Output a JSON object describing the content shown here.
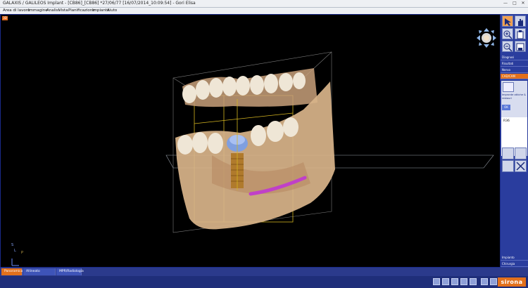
{
  "window": {
    "title": "GALAXIS / GALILEOS Implant - [CB86]_[CB86] *27/06/77 [16/07/2014_10:09:54] - Gori Elisa",
    "controls": {
      "minimize": "—",
      "maximize": "□",
      "close": "✕"
    }
  },
  "menu": [
    "Area di lavoro",
    "Immagine",
    "Analisi",
    "Vista",
    "Pianificazione",
    "Impianto",
    "Aiuto"
  ],
  "viewport": {
    "label": "3D"
  },
  "orientation": {
    "s": "S",
    "l": "L",
    "p": "P"
  },
  "right_panel": {
    "categories": [
      "Diagnosi",
      "Risultati",
      "Nervo",
      "CAD/CAM"
    ],
    "active_category": "CAD/CAM",
    "section_title": "Impronte ottiche & restauri",
    "restorations": [
      {
        "label": "OK"
      },
      {
        "label": "R36"
      }
    ],
    "bottom_items": [
      "Impianto",
      "Chirurgia"
    ]
  },
  "tabs": [
    {
      "label": "Panoramica",
      "active": true
    },
    {
      "label": "Allineato all'impianto",
      "active": false
    },
    {
      "label": "MPR/Radiologia",
      "active": false
    }
  ],
  "brand": {
    "name": "sirona"
  },
  "colors": {
    "accent": "#e2701c",
    "panel": "#2a3d9e",
    "bone": "#d9b48a",
    "crown": "#7f9fe0",
    "implant": "#b07a2c",
    "nerve": "#c040c8"
  }
}
